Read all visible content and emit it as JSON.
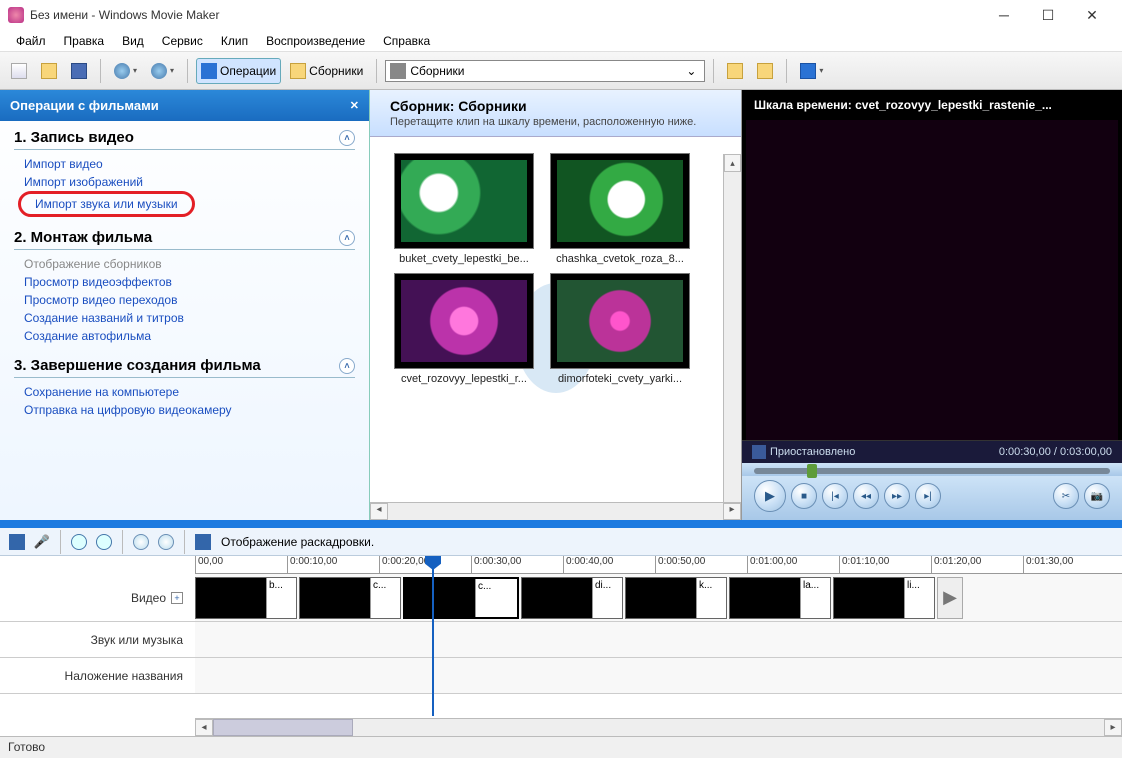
{
  "window": {
    "title": "Без имени - Windows Movie Maker"
  },
  "menu": [
    "Файл",
    "Правка",
    "Вид",
    "Сервис",
    "Клип",
    "Воспроизведение",
    "Справка"
  ],
  "toolbar": {
    "operations": "Операции",
    "collections_btn": "Сборники",
    "collections_combo": "Сборники"
  },
  "tasks": {
    "header": "Операции с фильмами",
    "sections": [
      {
        "title": "1. Запись видео",
        "links": [
          "Импорт видео",
          "Импорт изображений",
          "Импорт звука или музыки"
        ],
        "highlight_index": 2
      },
      {
        "title": "2. Монтаж фильма",
        "links": [
          "Отображение сборников",
          "Просмотр видеоэффектов",
          "Просмотр видео переходов",
          "Создание названий и титров",
          "Создание автофильма"
        ],
        "muted_index": 0
      },
      {
        "title": "3. Завершение создания фильма",
        "links": [
          "Сохранение на компьютере",
          "Отправка на цифровую видеокамеру"
        ]
      }
    ]
  },
  "collection": {
    "title": "Сборник: Сборники",
    "subtitle": "Перетащите клип на шкалу времени, расположенную ниже.",
    "items": [
      {
        "name": "buket_cvety_lepestki_be...",
        "cls": "flower1"
      },
      {
        "name": "chashka_cvetok_roza_8...",
        "cls": "flower2"
      },
      {
        "name": "cvet_rozovyy_lepestki_r...",
        "cls": "flower3"
      },
      {
        "name": "dimorfoteki_cvety_yarki...",
        "cls": "flower4"
      }
    ]
  },
  "preview": {
    "title": "Шкала времени: cvet_rozovyy_lepestki_rastenie_...",
    "status": "Приостановлено",
    "time": "0:00:30,00 / 0:03:00,00"
  },
  "timeline": {
    "toolbar_label": "Отображение раскадровки.",
    "ticks": [
      "00,00",
      "0:00:10,00",
      "0:00:20,00",
      "0:00:30,00",
      "0:00:40,00",
      "0:00:50,00",
      "0:01:00,00",
      "0:01:10,00",
      "0:01:20,00",
      "0:01:30,00"
    ],
    "rows": {
      "video": "Видео",
      "audio": "Звук или музыка",
      "title": "Наложение названия"
    },
    "clips": [
      {
        "label": "b...",
        "cls": "flower1"
      },
      {
        "label": "c...",
        "cls": "flower2"
      },
      {
        "label": "c...",
        "cls": "flower3",
        "active": true,
        "wide": true
      },
      {
        "label": "di...",
        "cls": "flower4"
      },
      {
        "label": "k...",
        "cls": "flower6"
      },
      {
        "label": "la...",
        "cls": "flower7"
      },
      {
        "label": "li...",
        "cls": "flower8"
      }
    ]
  },
  "status": "Готово"
}
